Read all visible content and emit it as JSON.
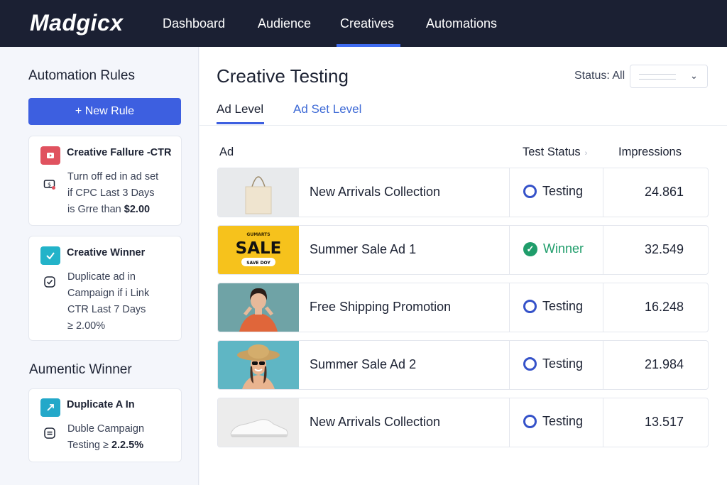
{
  "app": {
    "logo": "Madgicx"
  },
  "nav": {
    "items": [
      "Dashboard",
      "Audience",
      "Creatives",
      "Automations"
    ],
    "active": "Creatives"
  },
  "sidebar": {
    "title": "Automation Rules",
    "new_rule_label": "+ New Rule",
    "rules": [
      {
        "title": "Creative Fallure -CTR",
        "lines": [
          "Turn off ed in ad set",
          "if  CPC Last 3 Days",
          "is Grre than "
        ],
        "highlight": "$2.00",
        "badge_color": "#e0525f",
        "icon": "dollar-swap-icon"
      },
      {
        "title": "Creative Winner",
        "lines": [
          "Duplicate ad in",
          "Campaign if i Link",
          "CTR Last 7 Days",
          "≥ 2.00%"
        ],
        "badge_color": "#23b3c9",
        "icon": "check-square-icon"
      }
    ],
    "section2_title": "Aumentic Winner",
    "rule3": {
      "title": "Duplicate A In",
      "lines": [
        "Duble Campaign",
        "Testing  ≥ "
      ],
      "highlight": "2.2.5%",
      "badge_color": "#23a8c9",
      "icon": "list-square-icon"
    }
  },
  "main": {
    "title": "Creative Testing",
    "status_label": "Status: All",
    "tabs": [
      "Ad Level",
      "Ad Set Level"
    ],
    "columns": {
      "ad": "Ad",
      "status": "Test Status",
      "impressions": "Impressions"
    },
    "rows": [
      {
        "name": "New Arrivals Collection",
        "status": "Testing",
        "impressions": "24.861",
        "thumb": "tote-bag"
      },
      {
        "name": "Summer Sale Ad 1",
        "status": "Winner",
        "impressions": "32.549",
        "thumb": "sale-banner",
        "sale_small": "GUMARTS",
        "sale_big": "SALE",
        "sale_pill": "SAVE DOY"
      },
      {
        "name": "Free Shipping Promotion",
        "status": "Testing",
        "impressions": "16.248",
        "thumb": "woman-orange"
      },
      {
        "name": "Summer Sale Ad 2",
        "status": "Testing",
        "impressions": "21.984",
        "thumb": "woman-hat"
      },
      {
        "name": "New Arrivals Collection",
        "status": "Testing",
        "impressions": "13.517",
        "thumb": "sneaker"
      }
    ]
  },
  "colors": {
    "nav_bg": "#1b2033",
    "accent": "#3d5fe0",
    "winner": "#1f9d6b",
    "testing": "#3552c9"
  }
}
